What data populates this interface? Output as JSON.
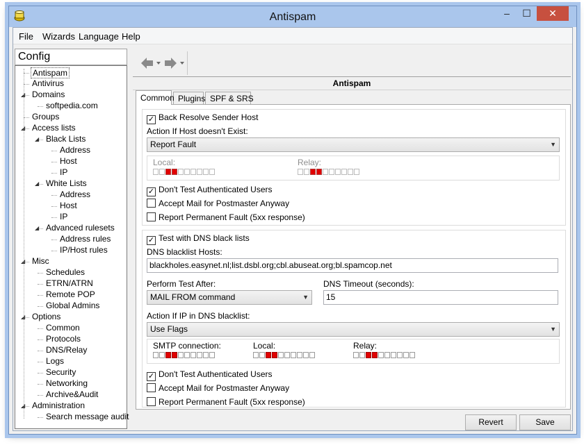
{
  "window": {
    "title": "Antispam"
  },
  "menu": [
    "File",
    "Wizards",
    "Language",
    "Help"
  ],
  "sidebar": {
    "title": "Config",
    "tree": [
      {
        "label": "Antispam",
        "level": 1,
        "selected": true
      },
      {
        "label": "Antivirus",
        "level": 1
      },
      {
        "label": "Domains",
        "level": 1,
        "expander": true
      },
      {
        "label": "softpedia.com",
        "level": 2
      },
      {
        "label": "Groups",
        "level": 1
      },
      {
        "label": "Access lists",
        "level": 1,
        "expander": true
      },
      {
        "label": "Black Lists",
        "level": 2,
        "expander": true
      },
      {
        "label": "Address",
        "level": 3
      },
      {
        "label": "Host",
        "level": 3
      },
      {
        "label": "IP",
        "level": 3
      },
      {
        "label": "White Lists",
        "level": 2,
        "expander": true
      },
      {
        "label": "Address",
        "level": 3
      },
      {
        "label": "Host",
        "level": 3
      },
      {
        "label": "IP",
        "level": 3
      },
      {
        "label": "Advanced rulesets",
        "level": 2,
        "expander": true
      },
      {
        "label": "Address rules",
        "level": 3
      },
      {
        "label": "IP/Host rules",
        "level": 3
      },
      {
        "label": "Misc",
        "level": 1,
        "expander": true
      },
      {
        "label": "Schedules",
        "level": 2
      },
      {
        "label": "ETRN/ATRN",
        "level": 2
      },
      {
        "label": "Remote POP",
        "level": 2
      },
      {
        "label": "Global Admins",
        "level": 2
      },
      {
        "label": "Options",
        "level": 1,
        "expander": true
      },
      {
        "label": "Common",
        "level": 2
      },
      {
        "label": "Protocols",
        "level": 2
      },
      {
        "label": "DNS/Relay",
        "level": 2
      },
      {
        "label": "Logs",
        "level": 2
      },
      {
        "label": "Security",
        "level": 2
      },
      {
        "label": "Networking",
        "level": 2
      },
      {
        "label": "Archive&Audit",
        "level": 2
      },
      {
        "label": "Administration",
        "level": 1,
        "expander": true
      },
      {
        "label": "Search message audit",
        "level": 2
      }
    ]
  },
  "panel": {
    "header": "Antispam"
  },
  "tabs": [
    "Common",
    "Plugins",
    "SPF & SRS"
  ],
  "section1": {
    "back_resolve": {
      "label": "Back Resolve Sender Host",
      "checked": true
    },
    "action_label": "Action If Host doesn't Exist:",
    "action_value": "Report Fault",
    "local_label": "Local:",
    "relay_label": "Relay:",
    "local_flags": [
      false,
      false,
      true,
      true,
      false,
      false,
      false,
      false,
      false,
      false
    ],
    "relay_flags": [
      false,
      false,
      true,
      true,
      false,
      false,
      false,
      false,
      false,
      false
    ],
    "dont_test": {
      "label": "Don't Test Authenticated Users",
      "checked": true
    },
    "accept_postmaster": {
      "label": "Accept Mail for Postmaster Anyway",
      "checked": false
    },
    "report_permanent": {
      "label": "Report Permanent Fault (5xx response)",
      "checked": false
    }
  },
  "section2": {
    "test_dns": {
      "label": "Test with DNS black lists",
      "checked": true
    },
    "hosts_label": "DNS blacklist Hosts:",
    "hosts_value": "blackholes.easynet.nl;list.dsbl.org;cbl.abuseat.org;bl.spamcop.net",
    "perform_label": "Perform Test After:",
    "perform_value": "MAIL FROM command",
    "timeout_label": "DNS Timeout (seconds):",
    "timeout_value": "15",
    "action_ip_label": "Action If IP in DNS blacklist:",
    "action_ip_value": "Use Flags",
    "smtp_label": "SMTP connection:",
    "local_label": "Local:",
    "relay_label": "Relay:",
    "smtp_flags": [
      false,
      false,
      true,
      true,
      false,
      false,
      false,
      false,
      false,
      false
    ],
    "local_flags": [
      false,
      false,
      true,
      true,
      false,
      false,
      false,
      false,
      false,
      false
    ],
    "relay_flags": [
      false,
      false,
      true,
      true,
      false,
      false,
      false,
      false,
      false,
      false
    ],
    "dont_test": {
      "label": "Don't Test Authenticated Users",
      "checked": true
    },
    "accept_postmaster": {
      "label": "Accept Mail for Postmaster Anyway",
      "checked": false
    },
    "report_permanent": {
      "label": "Report Permanent Fault (5xx response)",
      "checked": false
    }
  },
  "buttons": {
    "revert": "Revert",
    "save": "Save"
  },
  "colors": {
    "titlebar": "#aac6ec",
    "flag_on": "#e10000",
    "close": "#c7503f"
  }
}
